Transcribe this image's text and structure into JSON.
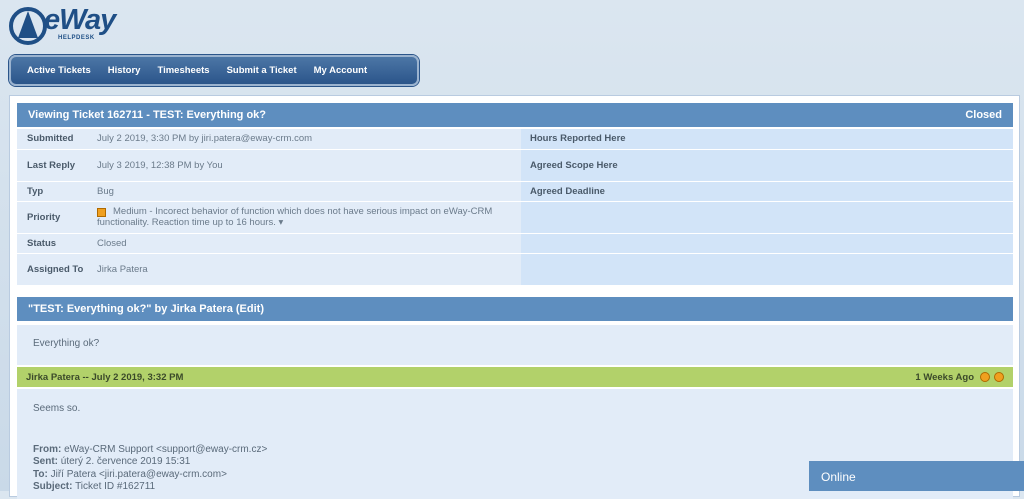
{
  "logo": {
    "brand": "eWay",
    "sub": "HELPDESK"
  },
  "nav": [
    "Active Tickets",
    "History",
    "Timesheets",
    "Submit a Ticket",
    "My Account"
  ],
  "ticket": {
    "title": "Viewing Ticket 162711 - TEST: Everything ok?",
    "status_badge": "Closed",
    "fields": {
      "submitted_label": "Submitted",
      "submitted_value": "July 2 2019, 3:30 PM by jiri.patera@eway-crm.com",
      "last_reply_label": "Last Reply",
      "last_reply_value": "July 3 2019, 12:38 PM by You",
      "typ_label": "Typ",
      "typ_value": "Bug",
      "priority_label": "Priority",
      "priority_value": "Medium - Incorect behavior of function which does not have serious impact on eWay-CRM functionality. Reaction time up to 16 hours. ▾",
      "status_label": "Status",
      "status_value": "Closed",
      "assigned_label": "Assigned To",
      "assigned_value": "Jirka Patera"
    },
    "right_labels": {
      "hours": "Hours Reported Here",
      "scope": "Agreed Scope Here",
      "deadline": "Agreed Deadline"
    }
  },
  "message": {
    "header": "\"TEST: Everything ok?\" by Jirka Patera  (Edit)",
    "body": "Everything ok?"
  },
  "reply": {
    "header": "Jirka Patera -- July 2 2019, 3:32 PM",
    "ago": "1 Weeks Ago",
    "body": "Seems so.",
    "from_label": "From:",
    "from_value": "eWay-CRM Support <support@eway-crm.cz>",
    "sent_label": "Sent:",
    "sent_value": "úterý 2. července 2019 15:31",
    "to_label": "To:",
    "to_value": "Jiří Patera <jiri.patera@eway-crm.com>",
    "subject_label": "Subject:",
    "subject_value": "Ticket ID #162711"
  },
  "online": "Online"
}
